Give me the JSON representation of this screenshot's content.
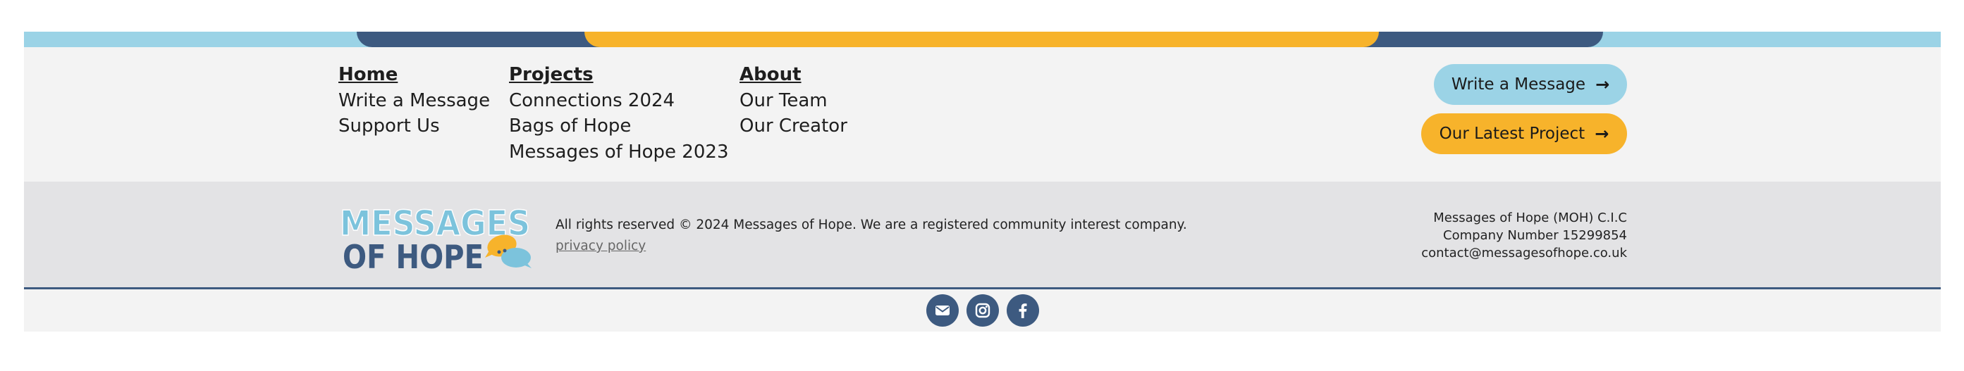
{
  "colors": {
    "light_blue": "#9bd3e6",
    "navy": "#3d5a80",
    "yellow": "#f7b32b",
    "nav_bg": "#f3f3f3",
    "info_bg": "#e3e3e5"
  },
  "nav": {
    "home": {
      "heading": "Home",
      "links": [
        "Write a Message",
        "Support Us"
      ]
    },
    "projects": {
      "heading": "Projects",
      "links": [
        "Connections 2024",
        "Bags of Hope",
        "Messages of Hope 2023"
      ]
    },
    "about": {
      "heading": "About",
      "links": [
        "Our Team",
        "Our Creator"
      ]
    }
  },
  "buttons": {
    "write_message": "Write a Message",
    "latest_project": "Our Latest Project",
    "arrow": "→"
  },
  "logo": {
    "line1": "MESSAGES",
    "line2": "OF HOPE"
  },
  "footer": {
    "rights": "All rights reserved © 2024 Messages of Hope. We are a registered community interest company.",
    "privacy": "privacy policy",
    "company_name": "Messages of Hope (MOH) C.I.C",
    "company_number": "Company Number 15299854",
    "email": "contact@messagesofhope.co.uk"
  },
  "social": [
    "envelope-icon",
    "instagram-icon",
    "facebook-icon"
  ]
}
